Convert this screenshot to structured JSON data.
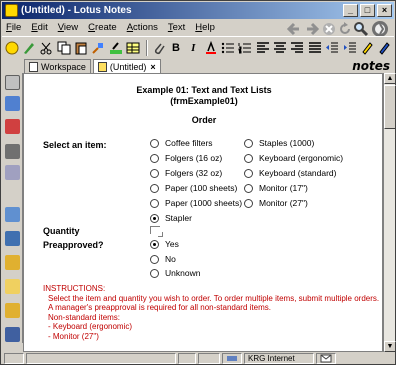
{
  "window": {
    "title": "(Untitled) - Lotus Notes",
    "min_glyph": "_",
    "max_glyph": "□",
    "close_glyph": "×"
  },
  "menu": [
    "File",
    "Edit",
    "View",
    "Create",
    "Actions",
    "Text",
    "Help"
  ],
  "tabs": {
    "workspace": "Workspace",
    "untitled": "(Untitled)",
    "close_glyph": "×"
  },
  "brand": "notes",
  "toolbar": {
    "bold": "B",
    "italic": "I"
  },
  "form": {
    "title_line1": "Example 01: Text and Text Lists",
    "title_line2": "(frmExample01)",
    "heading": "Order",
    "select_label": "Select an item:",
    "items_col1": [
      "Coffee filters",
      "Folgers (16 oz)",
      "Folgers (32 oz)",
      "Paper (100 sheets)",
      "Paper (1000 sheets)",
      "Stapler"
    ],
    "items_col2": [
      "Staples (1000)",
      "Keyboard (ergonomic)",
      "Keyboard (standard)",
      "Monitor (17\")",
      "Monitor (27\")"
    ],
    "selected_item": "Stapler",
    "quantity_label": "Quantity",
    "preapproved_label": "Preapproved?",
    "preapproved_options": [
      "Yes",
      "No",
      "Unknown"
    ],
    "preapproved_selected": "Yes"
  },
  "instructions": {
    "heading": "INSTRUCTIONS:",
    "lines": [
      "Select the item and quantity you wish to order. To order multiple items, submit multiple orders.",
      "A manager's preapproval is required for all non-standard items.",
      "Non-standard items:",
      "- Keyboard (ergonomic)",
      "- Monitor (27\")"
    ]
  },
  "status": {
    "location": "KRG Internet"
  },
  "colors": {
    "title_bar": "#0a246a",
    "instructions_text": "#c00000",
    "chrome": "#d4d0c8"
  }
}
